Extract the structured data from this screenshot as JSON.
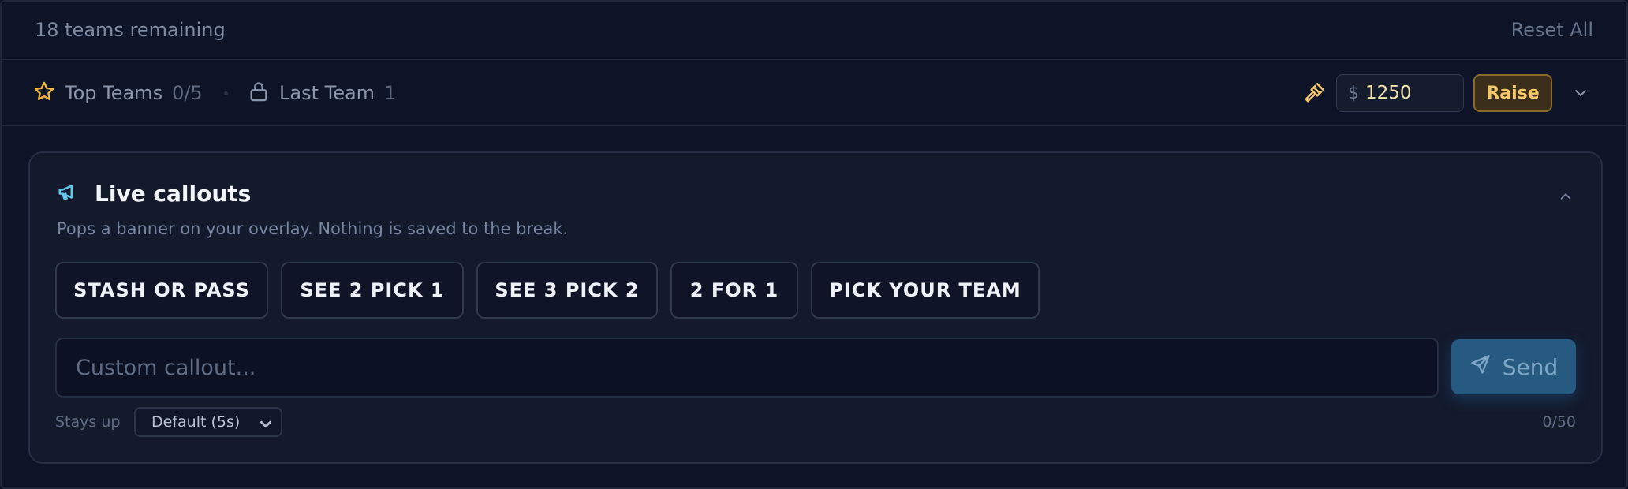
{
  "header": {
    "teams_remaining": "18 teams remaining",
    "reset_label": "Reset All"
  },
  "filters": {
    "top_teams": {
      "label": "Top Teams",
      "count": "0/5",
      "icon": "star-icon",
      "icon_color": "#f5b942"
    },
    "last_team": {
      "label": "Last Team",
      "count": "1",
      "icon": "lock-icon"
    }
  },
  "bid": {
    "icon": "gavel-icon",
    "currency": "$",
    "value": "1250",
    "raise_label": "Raise",
    "accent": "#f5c86a"
  },
  "card": {
    "icon": "megaphone-icon",
    "title": "Live callouts",
    "subtitle": "Pops a banner on your overlay. Nothing is saved to the break.",
    "callouts": [
      {
        "label": "STASH OR PASS"
      },
      {
        "label": "SEE 2 PICK 1"
      },
      {
        "label": "SEE 3 PICK 2"
      },
      {
        "label": "2 FOR 1"
      },
      {
        "label": "PICK YOUR TEAM"
      }
    ],
    "custom_placeholder": "Custom callout...",
    "send_label": "Send",
    "stays_label": "Stays up",
    "stays_value": "Default (5s)",
    "char_count": "0/50"
  }
}
